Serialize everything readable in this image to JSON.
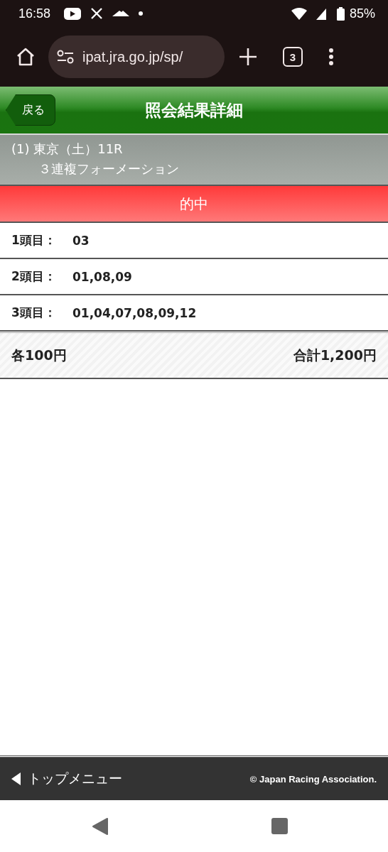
{
  "status_bar": {
    "time": "16:58",
    "battery": "85%"
  },
  "browser": {
    "url": "ipat.jra.go.jp/sp/",
    "tab_count": "3"
  },
  "header": {
    "back": "戻る",
    "title": "照会結果詳細"
  },
  "race": {
    "line1": "(1) 東京（土）11R",
    "line2": "３連複フォーメーション"
  },
  "result": {
    "label": "的中"
  },
  "rows": [
    {
      "label": "1頭目：",
      "value": "03"
    },
    {
      "label": "2頭目：",
      "value": "01,08,09"
    },
    {
      "label": "3頭目：",
      "value": "01,04,07,08,09,12"
    }
  ],
  "totals": {
    "each": "各100円",
    "total": "合計1,200円"
  },
  "footer": {
    "menu": "トップメニュー",
    "copyright": "© Japan Racing Association."
  }
}
